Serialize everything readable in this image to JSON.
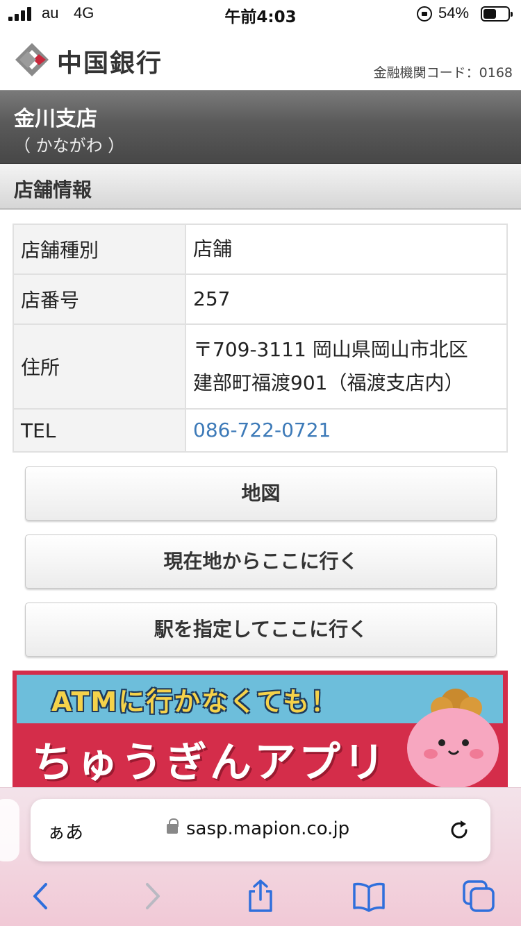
{
  "status_bar": {
    "carrier": "au",
    "network": "4G",
    "time": "午前4:03",
    "battery_percent": "54%",
    "battery_level": 0.54
  },
  "header": {
    "bank_name": "中国銀行",
    "institution_code": "金融機関コード：0168"
  },
  "branch": {
    "name": "金川支店",
    "kana": "（ かながわ ）"
  },
  "section": {
    "title": "店舗情報"
  },
  "info_table": {
    "rows": [
      {
        "label": "店舗種別",
        "value": "店舗"
      },
      {
        "label": "店番号",
        "value": "257"
      },
      {
        "label": "住所",
        "value_line1": "〒709-3111  岡山県岡山市北区",
        "value_line2": "建部町福渡901（福渡支店内）"
      },
      {
        "label": "TEL",
        "value": "086-722-0721"
      }
    ]
  },
  "buttons": {
    "map": "地図",
    "route_from_current": "現在地からここに行く",
    "route_from_station": "駅を指定してここに行く"
  },
  "banner": {
    "catch": "ATMに行かなくても！",
    "app_name": "ちゅうぎんアプリ"
  },
  "browser": {
    "text_size_label": "ぁあ",
    "url": "sasp.mapion.co.jp"
  },
  "colors": {
    "link": "#3d7ab8",
    "brand_red": "#d42d4a",
    "brand_gray": "#5a5a5a"
  }
}
